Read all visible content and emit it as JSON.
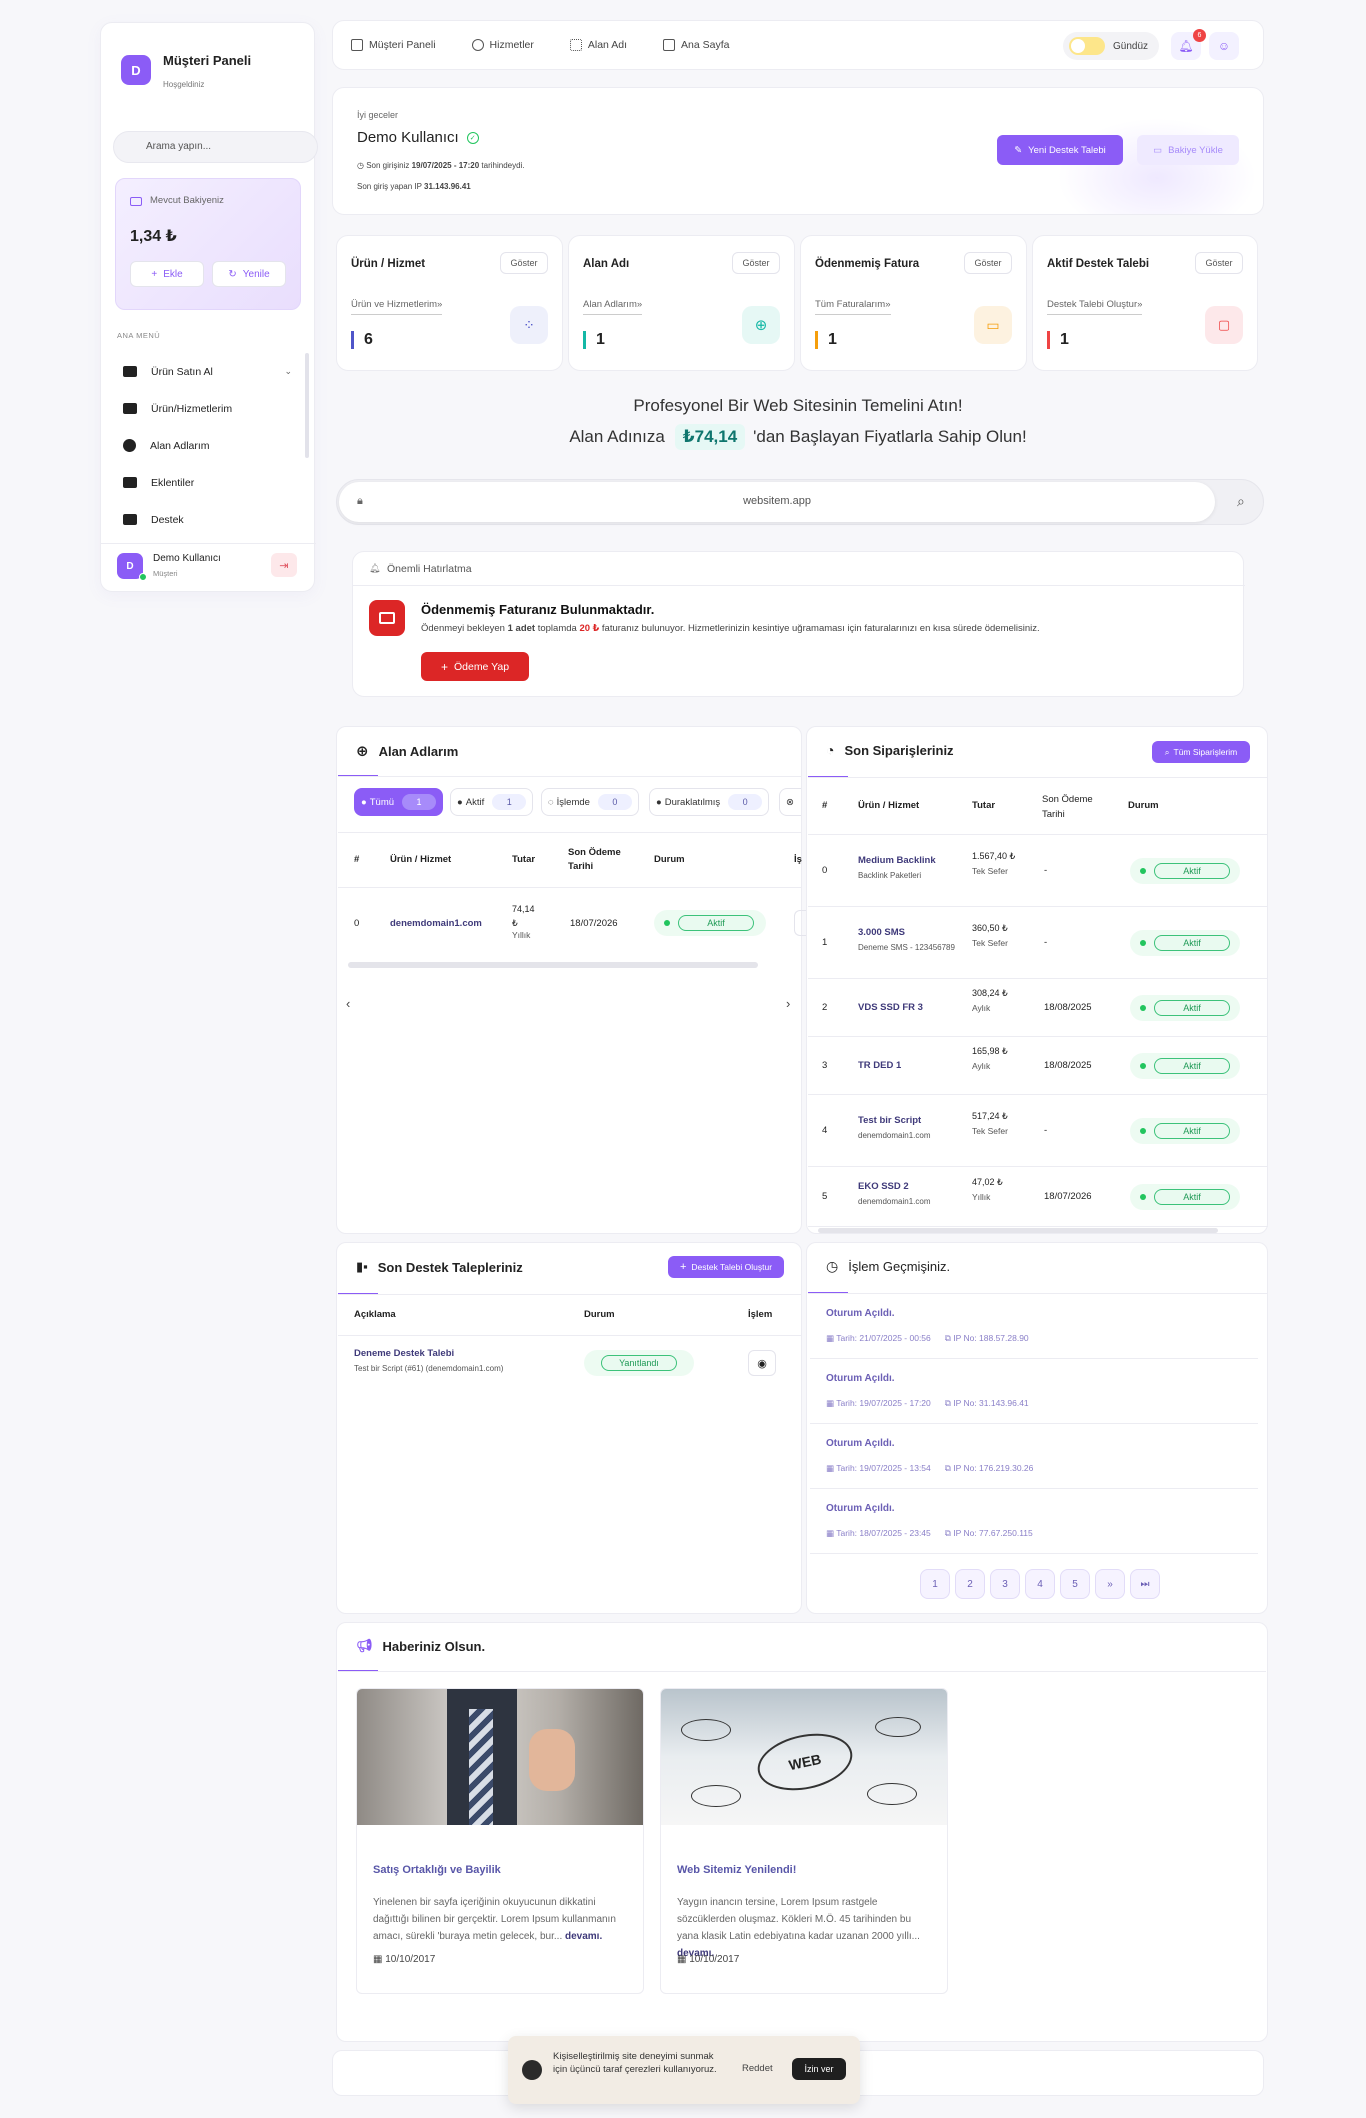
{
  "sidebar": {
    "avatar_letter": "D",
    "title": "Müşteri Paneli",
    "subtitle": "Hoşgeldiniz",
    "search_placeholder": "Arama yapın...",
    "balance": {
      "label": "Mevcut Bakiyeniz",
      "amount": "1,34 ₺",
      "add_label": "Ekle",
      "refresh_label": "Yenile"
    },
    "menu_heading": "ANA MENÜ",
    "items": [
      {
        "label": "Ürün Satın Al",
        "icon": "book-icon",
        "has_chevron": true
      },
      {
        "label": "Ürün/Hizmetlerim",
        "icon": "boxes-icon"
      },
      {
        "label": "Alan Adlarım",
        "icon": "globe-icon"
      },
      {
        "label": "Eklentiler",
        "icon": "server-icon"
      },
      {
        "label": "Destek",
        "icon": "ticket-icon"
      }
    ],
    "user": {
      "letter": "D",
      "name": "Demo Kullanıcı",
      "role": "Müşteri"
    }
  },
  "topnav": {
    "items": [
      "Müşteri Paneli",
      "Hizmetler",
      "Alan Adı",
      "Ana Sayfa"
    ],
    "theme_label": "Gündüz",
    "notification_count": "6"
  },
  "welcome": {
    "greeting": "İyi geceler",
    "name": "Demo Kullanıcı",
    "last_login_prefix": "Son girişiniz",
    "last_login_date": "19/07/2025 - 17:20",
    "last_login_suffix": "tarihindeydi.",
    "ip_prefix": "Son giriş yapan IP",
    "ip": "31.143.96.41",
    "new_ticket_label": "Yeni Destek Talebi",
    "load_balance_label": "Bakiye Yükle"
  },
  "stats": [
    {
      "title": "Ürün / Hizmet",
      "show": "Göster",
      "sub": "Ürün ve Hizmetlerim»",
      "value": "6",
      "color": "#4f55c9",
      "bg": "#eef0fb",
      "icon": "apps-icon"
    },
    {
      "title": "Alan Adı",
      "show": "Göster",
      "sub": "Alan Adlarım»",
      "value": "1",
      "color": "#14b8a6",
      "bg": "#e6f8f5",
      "icon": "globe-icon"
    },
    {
      "title": "Ödenmemiş Fatura",
      "show": "Göster",
      "sub": "Tüm Faturalarım»",
      "value": "1",
      "color": "#f59e0b",
      "bg": "#fdf2e0",
      "icon": "card-icon"
    },
    {
      "title": "Aktif Destek Talebi",
      "show": "Göster",
      "sub": "Destek Talebi Oluştur»",
      "value": "1",
      "color": "#ef4444",
      "bg": "#fde8ea",
      "icon": "chat-icon"
    }
  ],
  "promo": {
    "line1": "Profesyonel Bir Web Sitesinin Temelini Atın!",
    "line2_pre": "Alan Adınıza",
    "price": "₺74,14",
    "line2_post": "'dan Başlayan Fiyatlarla Sahip Olun!",
    "domain_placeholder": "websitem.app"
  },
  "reminder": {
    "header": "Önemli Hatırlatma",
    "title": "Ödenmemiş Faturanız Bulunmaktadır.",
    "text_pre": "Ödenmeyi bekleyen",
    "count": "1 adet",
    "text_mid": "toplamda",
    "amount": "20 ₺",
    "text_post": "faturanız bulunuyor. Hizmetlerinizin kesintiye uğramaması için faturalarınızı en kısa sürede ödemelisiniz.",
    "pay_label": "Ödeme Yap"
  },
  "domains": {
    "title": "Alan Adlarım",
    "filters": [
      {
        "label": "Tümü",
        "count": "1"
      },
      {
        "label": "Aktif",
        "count": "1"
      },
      {
        "label": "İşlemde",
        "count": "0"
      },
      {
        "label": "Duraklatılmış",
        "count": "0"
      },
      {
        "label": "İ",
        "count": ""
      }
    ],
    "columns": [
      "#",
      "Ürün / Hizmet",
      "Tutar",
      "Son Ödeme Tarihi",
      "Durum",
      "İş"
    ],
    "rows": [
      {
        "idx": "0",
        "name": "denemdomain1.com",
        "amount": "74,14 ₺",
        "period": "Yıllık",
        "date": "18/07/2026",
        "status": "Aktif"
      }
    ]
  },
  "orders": {
    "title": "Son Siparişleriniz",
    "all_label": "Tüm Siparişlerim",
    "columns": [
      "#",
      "Ürün / Hizmet",
      "Tutar",
      "Son Ödeme Tarihi",
      "Durum"
    ],
    "rows": [
      {
        "idx": "0",
        "name": "Medium Backlink",
        "sub": "Backlink Paketleri",
        "amount": "1.567,40 ₺",
        "period": "Tek Sefer",
        "date": "-",
        "status": "Aktif"
      },
      {
        "idx": "1",
        "name": "3.000 SMS",
        "sub": "Deneme SMS - 123456789",
        "amount": "360,50 ₺",
        "period": "Tek Sefer",
        "date": "-",
        "status": "Aktif"
      },
      {
        "idx": "2",
        "name": "VDS SSD FR 3",
        "sub": "",
        "amount": "308,24 ₺",
        "period": "Aylık",
        "date": "18/08/2025",
        "status": "Aktif"
      },
      {
        "idx": "3",
        "name": "TR DED 1",
        "sub": "",
        "amount": "165,98 ₺",
        "period": "Aylık",
        "date": "18/08/2025",
        "status": "Aktif"
      },
      {
        "idx": "4",
        "name": "Test bir Script",
        "sub": "denemdomain1.com",
        "amount": "517,24 ₺",
        "period": "Tek Sefer",
        "date": "-",
        "status": "Aktif"
      },
      {
        "idx": "5",
        "name": "EKO SSD 2",
        "sub": "denemdomain1.com",
        "amount": "47,02 ₺",
        "period": "Yıllık",
        "date": "18/07/2026",
        "status": "Aktif"
      }
    ]
  },
  "tickets": {
    "title": "Son Destek Talepleriniz",
    "create_label": "Destek Talebi Oluştur",
    "columns": [
      "Açıklama",
      "Durum",
      "İşlem"
    ],
    "rows": [
      {
        "title": "Deneme Destek Talebi",
        "sub": "Test bir Script (#61) (denemdomain1.com)",
        "status": "Yanıtlandı"
      }
    ]
  },
  "history": {
    "title": "İşlem Geçmişiniz.",
    "items": [
      {
        "title": "Oturum Açıldı.",
        "date": "Tarih: 21/07/2025 - 00:56",
        "ip": "IP No: 188.57.28.90"
      },
      {
        "title": "Oturum Açıldı.",
        "date": "Tarih: 19/07/2025 - 17:20",
        "ip": "IP No: 31.143.96.41"
      },
      {
        "title": "Oturum Açıldı.",
        "date": "Tarih: 19/07/2025 - 13:54",
        "ip": "IP No: 176.219.30.26"
      },
      {
        "title": "Oturum Açıldı.",
        "date": "Tarih: 18/07/2025 - 23:45",
        "ip": "IP No: 77.67.250.115"
      }
    ],
    "pages": [
      "1",
      "2",
      "3",
      "4",
      "5",
      "»",
      "⏭"
    ]
  },
  "news": {
    "title": "Haberiniz Olsun.",
    "items": [
      {
        "title": "Satış Ortaklığı ve Bayilik",
        "body": "Yinelenen bir sayfa içeriğinin okuyucunun dikkatini dağıttığı bilinen bir gerçektir. Lorem Ipsum kullanmanın amacı, sürekli 'buraya metin gelecek, bur...",
        "more": "devamı.",
        "date": "10/10/2017"
      },
      {
        "title": "Web Sitemiz Yenilendi!",
        "body": "Yaygın inancın tersine, Lorem Ipsum rastgele sözcüklerden oluşmaz. Kökleri M.Ö. 45 tarihinden bu yana klasik Latin edebiyatına kadar uzanan 2000 yıllı...",
        "more": "devamı.",
        "date": "10/10/2017"
      }
    ]
  },
  "cookie": {
    "text": "Kişiselleştirilmiş site deneyimi sunmak için üçüncü taraf çerezleri kullanıyoruz.",
    "reject_label": "Reddet",
    "accept_label": "İzin ver"
  }
}
